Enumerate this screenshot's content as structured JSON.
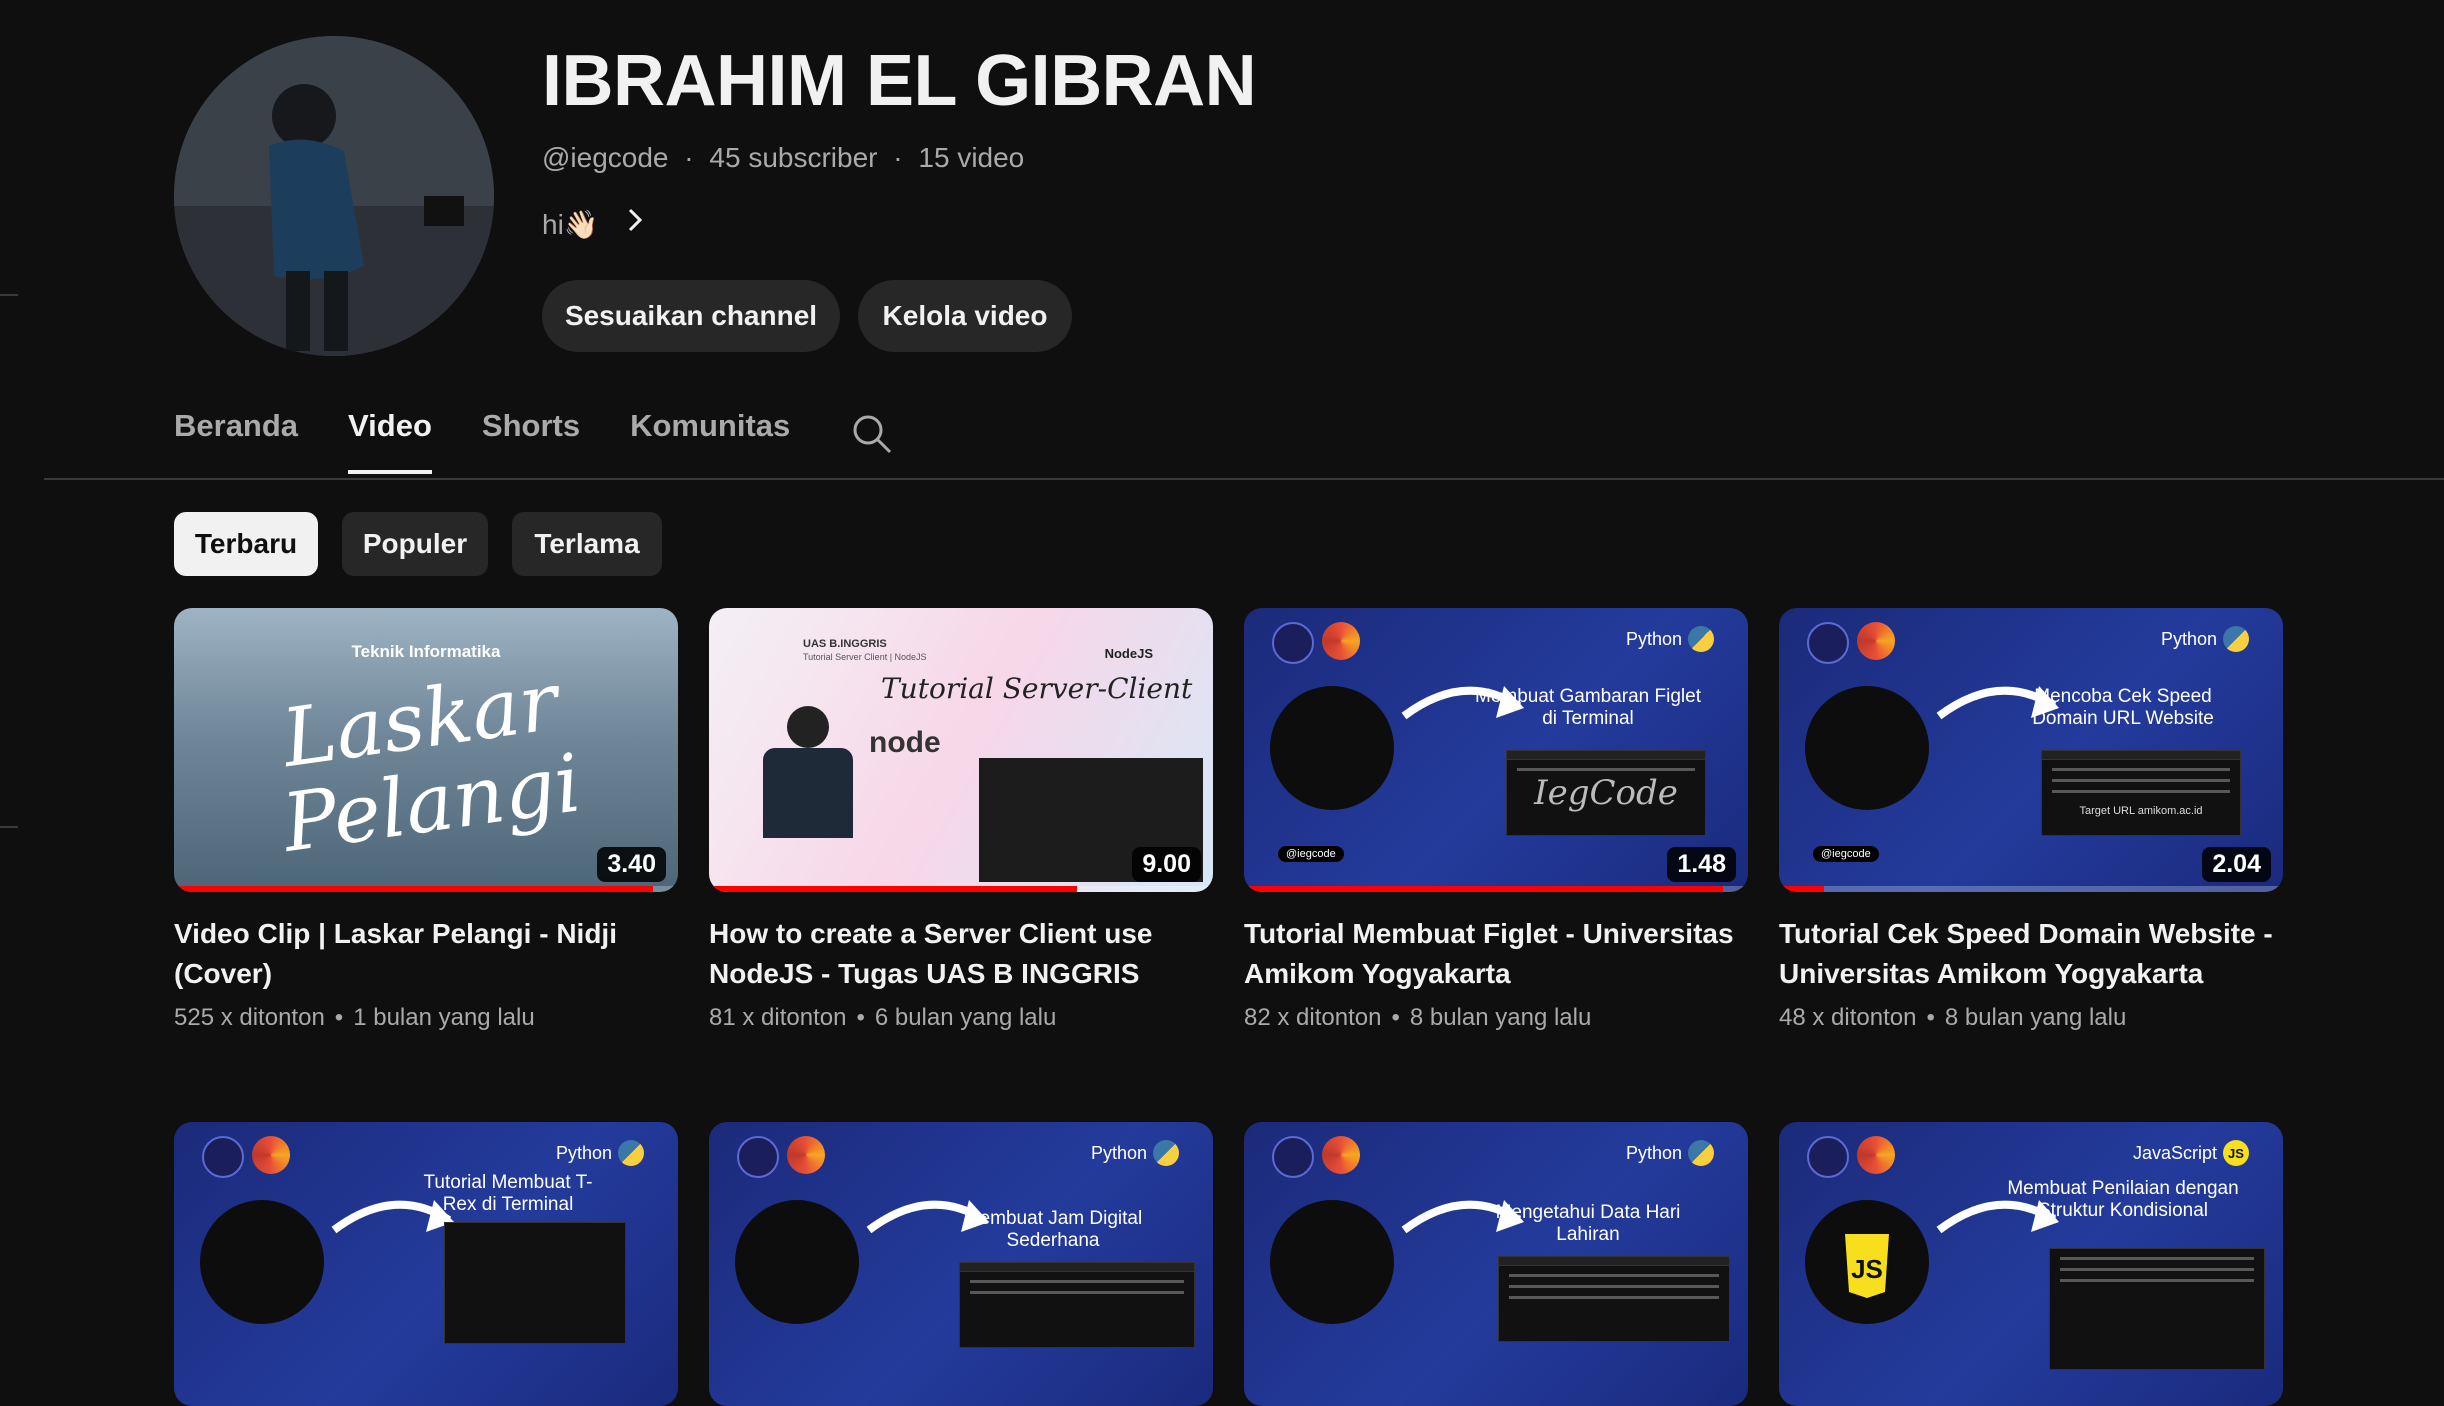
{
  "channel": {
    "name": "IBRAHIM EL GIBRAN",
    "handle": "@iegcode",
    "subscribers": "45 subscriber",
    "video_count": "15 video",
    "description": "hi👋🏻",
    "buttons": {
      "customize": "Sesuaikan channel",
      "manage": "Kelola video"
    }
  },
  "tabs": [
    "Beranda",
    "Video",
    "Shorts",
    "Komunitas"
  ],
  "active_tab": "Video",
  "chips": [
    "Terbaru",
    "Populer",
    "Terlama"
  ],
  "active_chip": "Terbaru",
  "videos": [
    {
      "title": "Video Clip | Laskar Pelangi - Nidji (Cover)",
      "views": "525 x ditonton",
      "age": "1 bulan yang lalu",
      "duration": "3.40",
      "watched": 0.95,
      "thumb_text": {
        "caption": "Teknik Informatika",
        "main": "Laskar Pelangi"
      }
    },
    {
      "title": "How to create a Server Client use NodeJS - Tugas UAS B INGGRIS",
      "views": "81 x ditonton",
      "age": "6 bulan yang lalu",
      "duration": "9.00",
      "watched": 0.73,
      "thumb_text": {
        "course": "UAS B.INGGRIS",
        "subtitle": "Tutorial Server Client | NodeJS",
        "tag": "NodeJS",
        "main": "Tutorial Server-Client",
        "logo": "node"
      }
    },
    {
      "title": "Tutorial Membuat Figlet - Universitas Amikom Yogyakarta",
      "views": "82 x ditonton",
      "age": "8 bulan yang lalu",
      "duration": "1.48",
      "watched": 0.95,
      "thumb_text": {
        "lang": "Python",
        "topic": "Membuat Gambaran Figlet di Terminal",
        "art": "IegCode",
        "handle": "@iegcode"
      }
    },
    {
      "title": "Tutorial Cek Speed Domain Website - Universitas Amikom Yogyakarta",
      "views": "48 x ditonton",
      "age": "8 bulan yang lalu",
      "duration": "2.04",
      "watched": 0.09,
      "thumb_text": {
        "lang": "Python",
        "topic": "Mencoba Cek Speed Domain URL Website",
        "footer": "Target URL amikom.ac.id",
        "handle": "@iegcode"
      }
    },
    {
      "thumb_text": {
        "lang": "Python",
        "topic": "Tutorial Membuat T-Rex di Terminal"
      }
    },
    {
      "thumb_text": {
        "lang": "Python",
        "topic": "Membuat Jam Digital Sederhana"
      }
    },
    {
      "thumb_text": {
        "lang": "Python",
        "topic": "Mengetahui Data Hari Lahiran"
      }
    },
    {
      "thumb_text": {
        "lang": "JavaScript",
        "topic": "Membuat Penilaian dengan Struktur Kondisional"
      }
    }
  ],
  "colors": {
    "background": "#0f0f0f",
    "chip": "#272727",
    "progress": "#ff0000",
    "secondary_text": "#aaaaaa"
  },
  "icons": [
    "search-icon",
    "chevron-right-icon",
    "python-icon",
    "javascript-icon",
    "arrow-icon"
  ]
}
